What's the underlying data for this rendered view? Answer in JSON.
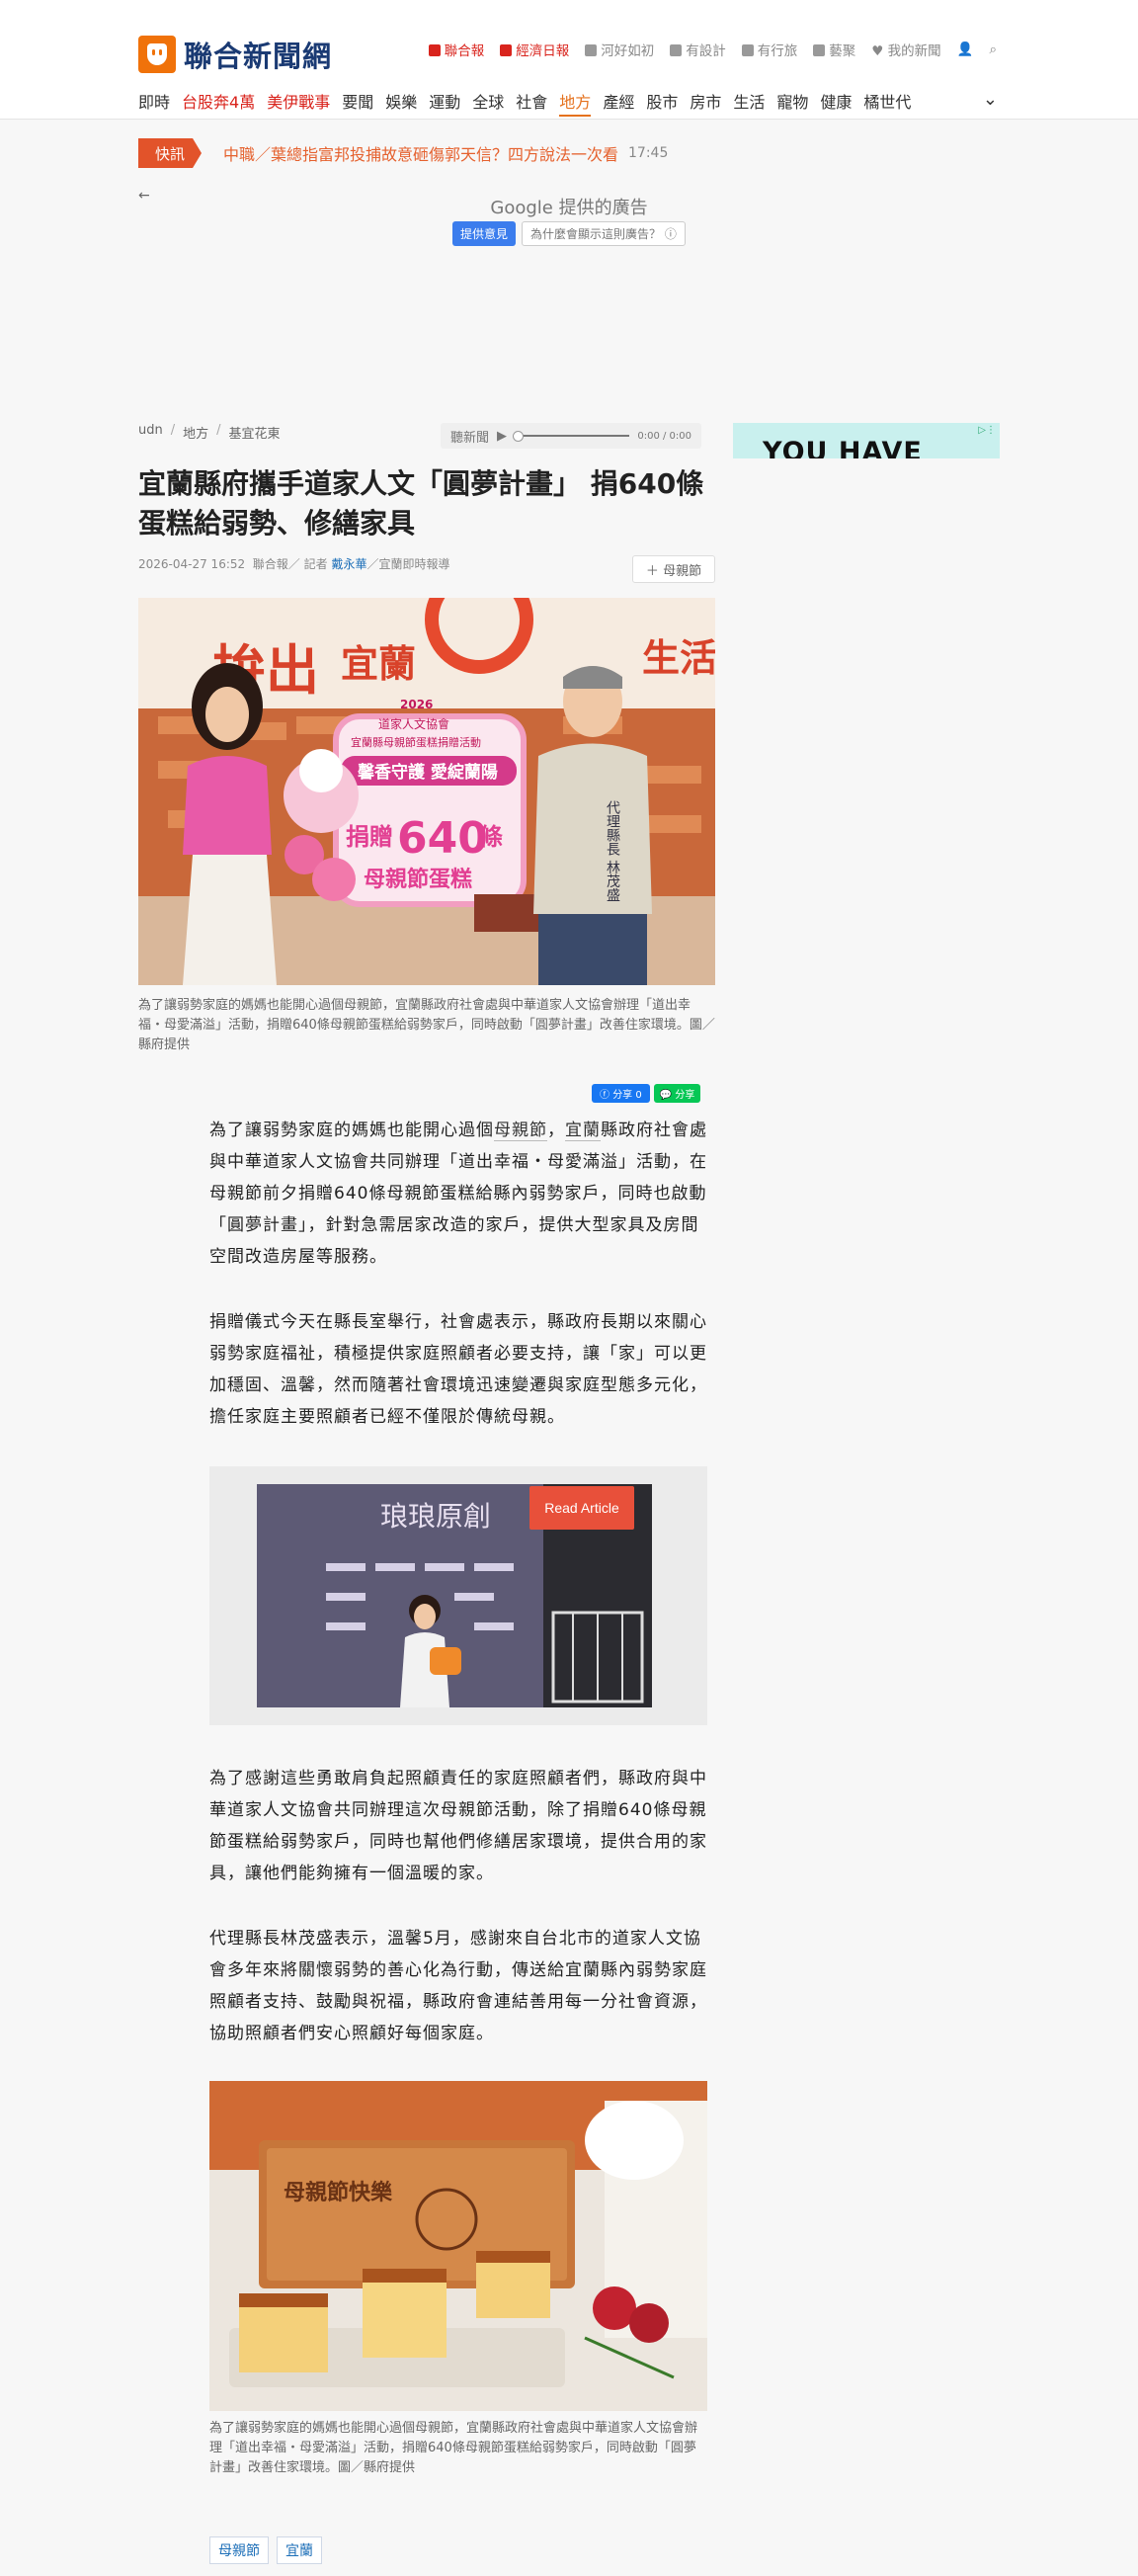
{
  "header": {
    "site_name": "聯合新聞網",
    "utility_links": [
      "聯合報",
      "經濟日報",
      "河好如初",
      "有設計",
      "有行旅",
      "藝聚",
      "我的新聞"
    ],
    "nav": [
      "即時",
      "台股奔4萬",
      "美伊戰事",
      "要聞",
      "娛樂",
      "運動",
      "全球",
      "社會",
      "地方",
      "產經",
      "股市",
      "房市",
      "生活",
      "寵物",
      "健康",
      "橘世代"
    ],
    "active_nav": "地方"
  },
  "breaking": {
    "label": "快訊",
    "text": "中職／葉總指富邦投捕故意砸傷郭天信？四方說法一次看",
    "time": "17:45"
  },
  "ad": {
    "title": "Google 提供的廣告",
    "feedback": "提供意見",
    "why": "為什麼會顯示這則廣告？ ⓘ",
    "side_text": "YOU HAVE ONLY"
  },
  "breadcrumb": [
    "udn",
    "地方",
    "基宜花東"
  ],
  "audio": {
    "label": "聽新聞",
    "time": "0:00 / 0:00"
  },
  "article": {
    "title": "宜蘭縣府攜手道家人文「圓夢計畫」 捐640條蛋糕給弱勢、修繕家具",
    "date": "2026-04-27 16:52",
    "source": "聯合報／ 記者",
    "reporter": "戴永華",
    "desk": "／宜蘭即時報導",
    "follow_tag": "母親節",
    "photo1_caption": "為了讓弱勢家庭的媽媽也能開心過個母親節，宜蘭縣政府社會處與中華道家人文協會辦理「道出幸福・母愛滿溢」活動，捐贈640條母親節蛋糕給弱勢家戶，同時啟動「圓夢計畫」改善住家環境。圖／縣府提供",
    "photo1_texts": {
      "backdrop_left": "拚出",
      "backdrop_mid": "宜蘭",
      "backdrop_right": "生活",
      "board_year": "2026",
      "board_org": "道家人文協會",
      "board_event": "宜蘭縣母親節蛋糕捐贈活動",
      "board_slogan": "馨香守護 愛綻蘭陽",
      "board_main_pre": "捐贈",
      "board_number": "640",
      "board_main_post": "條",
      "board_sub": "母親節蛋糕",
      "vest": "代理縣長 林茂盛"
    },
    "share_fb": "分享 0",
    "share_line": "分享",
    "paragraphs": {
      "p1a": "為了讓弱勢家庭的媽媽也能開心過個",
      "p1_link1": "母親節",
      "p1b": "，",
      "p1_link2": "宜蘭",
      "p1c": "縣政府社會處與中華道家人文協會共同辦理「道出幸福・母愛滿溢」活動，在母親節前夕捐贈640條母親節蛋糕給縣內弱勢家戶，同時也啟動「圓夢計畫」，針對急需居家改造的家戶，提供大型家具及房間空間改造房屋等服務。",
      "p2": "捐贈儀式今天在縣長室舉行，社會處表示，縣政府長期以來關心弱勢家庭福祉，積極提供家庭照顧者必要支持，讓「家」可以更加穩固、溫馨，然而隨著社會環境迅速變遷與家庭型態多元化，擔任家庭主要照顧者已經不僅限於傳統母親。",
      "p3": "為了感謝這些勇敢肩負起照顧責任的家庭照顧者們，縣政府與中華道家人文協會共同辦理這次母親節活動，除了捐贈640條母親節蛋糕給弱勢家戶，同時也幫他們修繕居家環境，提供合用的家具，讓他們能夠擁有一個溫暖的家。",
      "p4": "代理縣長林茂盛表示，溫馨5月，感謝來自台北市的道家人文協會多年來將關懷弱勢的善心化為行動，傳送給宜蘭縣內弱勢家庭照顧者支持、鼓勵與祝福，縣政府會連結善用每一分社會資源，協助照顧者們安心照顧好每個家庭。"
    },
    "related": {
      "button": "Read Article",
      "poster_title": "琅琅原創"
    },
    "photo2_caption": "為了讓弱勢家庭的媽媽也能開心過個母親節，宜蘭縣政府社會處與中華道家人文協會辦理「道出幸福・母愛滿溢」活動，捐贈640條母親節蛋糕給弱勢家戶，同時啟動「圓夢計畫」改善住家環境。圖／縣府提供",
    "photo2_text": "母親節快樂",
    "tags": [
      "母親節",
      "宜蘭"
    ]
  },
  "colors": {
    "brand_orange": "#f0720a",
    "brand_navy": "#1a3a73",
    "breaking_red": "#e2532a",
    "link_blue": "#1d6fb8"
  }
}
